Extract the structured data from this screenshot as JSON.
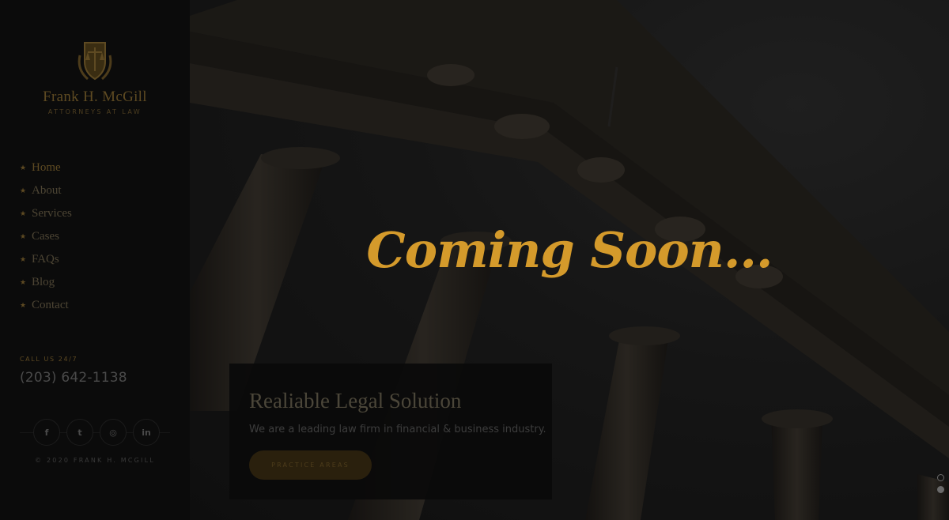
{
  "brand": {
    "name": "Frank H. McGill",
    "tagline": "ATTORNEYS AT LAW",
    "emblem_icon": "shield-scales-icon",
    "accent_color": "#d49a2b"
  },
  "nav": {
    "items": [
      {
        "label": "Home"
      },
      {
        "label": "About"
      },
      {
        "label": "Services"
      },
      {
        "label": "Cases"
      },
      {
        "label": "FAQs"
      },
      {
        "label": "Blog"
      },
      {
        "label": "Contact"
      }
    ],
    "bullet_icon": "star-icon"
  },
  "contact": {
    "call_label": "CALL US 24/7",
    "phone": "(203) 642-1138"
  },
  "social": [
    {
      "icon": "facebook-icon",
      "glyph": "f"
    },
    {
      "icon": "twitter-icon",
      "glyph": "t"
    },
    {
      "icon": "instagram-icon",
      "glyph": "◎"
    },
    {
      "icon": "linkedin-icon",
      "glyph": "in"
    }
  ],
  "footer": {
    "copyright": "© 2020 FRANK H. MCGILL"
  },
  "hero": {
    "headline": "Coming Soon...",
    "card_title": "Realiable Legal Solution",
    "card_text": "We are a leading law firm in financial & business industry.",
    "card_button": "PRACTICE AREAS"
  }
}
